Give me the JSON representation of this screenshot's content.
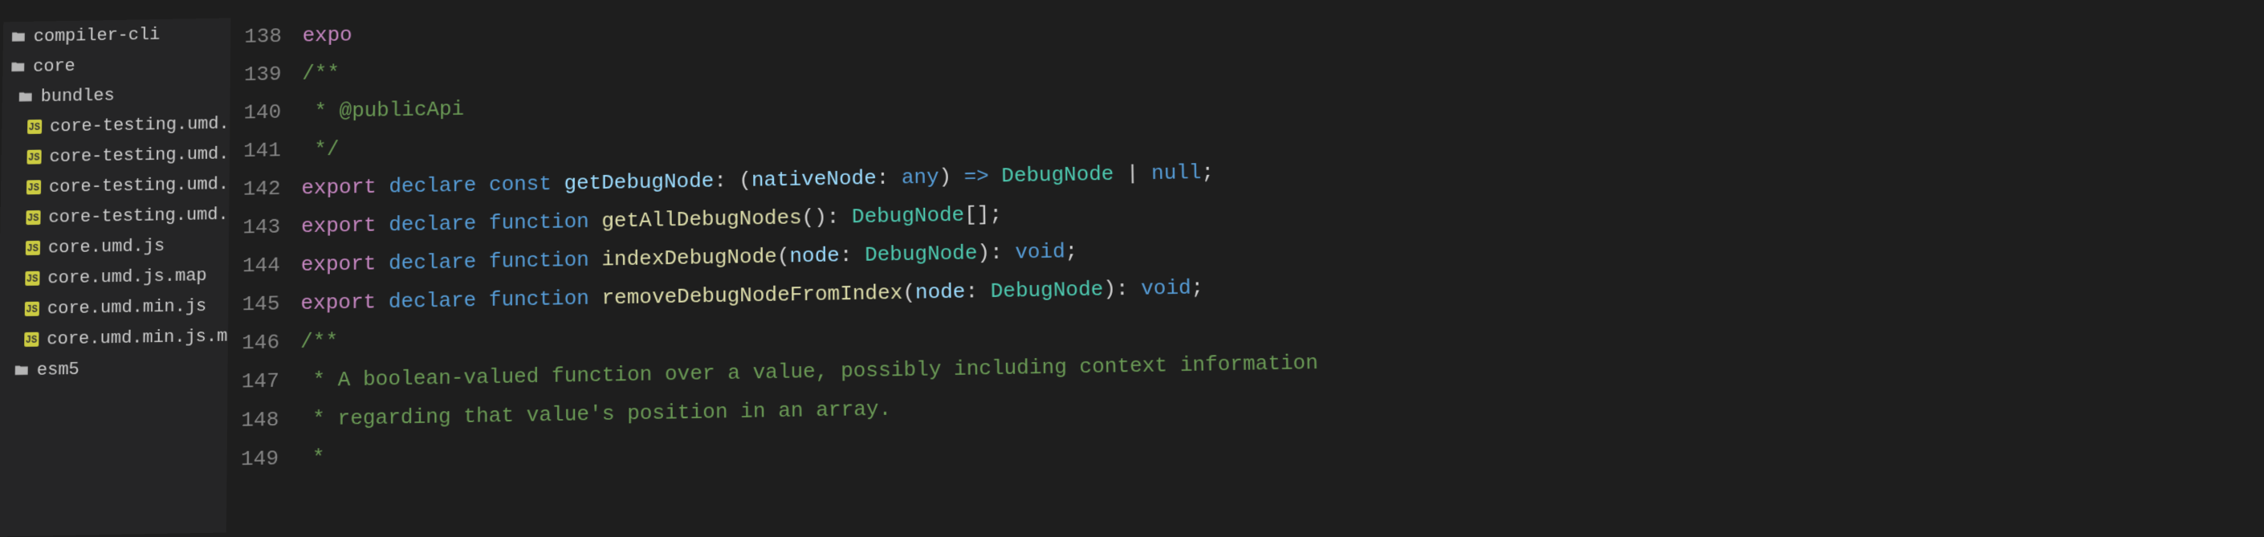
{
  "sidebar": {
    "items": [
      {
        "label": "compiler-cli",
        "type": "folder",
        "level": 1
      },
      {
        "label": "core",
        "type": "folder",
        "level": 1
      },
      {
        "label": "bundles",
        "type": "folder",
        "level": 2
      },
      {
        "label": "core-testing.umd.js",
        "type": "js",
        "level": 3
      },
      {
        "label": "core-testing.umd.js.map",
        "type": "js",
        "level": 3
      },
      {
        "label": "core-testing.umd.min.js",
        "type": "js",
        "level": 3
      },
      {
        "label": "core-testing.umd.min.js.map",
        "type": "js",
        "level": 3
      },
      {
        "label": "core.umd.js",
        "type": "js",
        "level": 3
      },
      {
        "label": "core.umd.js.map",
        "type": "js",
        "level": 3
      },
      {
        "label": "core.umd.min.js",
        "type": "js",
        "level": 3
      },
      {
        "label": "core.umd.min.js.map",
        "type": "js",
        "level": 3
      },
      {
        "label": "esm5",
        "type": "folder",
        "level": 2
      }
    ]
  },
  "editor": {
    "lineNumbers": [
      "138",
      "139",
      "140",
      "141",
      "142",
      "143",
      "144",
      "145",
      "146",
      "147",
      "148",
      "149"
    ],
    "lines": [
      [
        {
          "t": "keyword",
          "v": "expo"
        }
      ],
      [
        {
          "t": "comment",
          "v": "/**"
        }
      ],
      [
        {
          "t": "comment",
          "v": " * @publicApi"
        }
      ],
      [
        {
          "t": "comment",
          "v": " */"
        }
      ],
      [
        {
          "t": "keyword",
          "v": "export "
        },
        {
          "t": "declare",
          "v": "declare const "
        },
        {
          "t": "var",
          "v": "getDebugNode"
        },
        {
          "t": "punc",
          "v": ": ("
        },
        {
          "t": "var",
          "v": "nativeNode"
        },
        {
          "t": "punc",
          "v": ": "
        },
        {
          "t": "declare",
          "v": "any"
        },
        {
          "t": "punc",
          "v": ") "
        },
        {
          "t": "declare",
          "v": "=> "
        },
        {
          "t": "type",
          "v": "DebugNode"
        },
        {
          "t": "punc",
          "v": " | "
        },
        {
          "t": "declare",
          "v": "null"
        },
        {
          "t": "punc",
          "v": ";"
        }
      ],
      [
        {
          "t": "keyword",
          "v": "export "
        },
        {
          "t": "declare",
          "v": "declare function "
        },
        {
          "t": "func",
          "v": "getAllDebugNodes"
        },
        {
          "t": "punc",
          "v": "(): "
        },
        {
          "t": "type",
          "v": "DebugNode"
        },
        {
          "t": "punc",
          "v": "[];"
        }
      ],
      [
        {
          "t": "keyword",
          "v": "export "
        },
        {
          "t": "declare",
          "v": "declare function "
        },
        {
          "t": "func",
          "v": "indexDebugNode"
        },
        {
          "t": "punc",
          "v": "("
        },
        {
          "t": "var",
          "v": "node"
        },
        {
          "t": "punc",
          "v": ": "
        },
        {
          "t": "type",
          "v": "DebugNode"
        },
        {
          "t": "punc",
          "v": "): "
        },
        {
          "t": "declare",
          "v": "void"
        },
        {
          "t": "punc",
          "v": ";"
        }
      ],
      [
        {
          "t": "keyword",
          "v": "export "
        },
        {
          "t": "declare",
          "v": "declare function "
        },
        {
          "t": "func",
          "v": "removeDebugNodeFromIndex"
        },
        {
          "t": "punc",
          "v": "("
        },
        {
          "t": "var",
          "v": "node"
        },
        {
          "t": "punc",
          "v": ": "
        },
        {
          "t": "type",
          "v": "DebugNode"
        },
        {
          "t": "punc",
          "v": "): "
        },
        {
          "t": "declare",
          "v": "void"
        },
        {
          "t": "punc",
          "v": ";"
        }
      ],
      [
        {
          "t": "comment",
          "v": "/**"
        }
      ],
      [
        {
          "t": "comment",
          "v": " * A boolean-valued function over a value, possibly including context information"
        }
      ],
      [
        {
          "t": "comment",
          "v": " * regarding that value's position in an array."
        }
      ],
      [
        {
          "t": "comment",
          "v": " *"
        }
      ]
    ]
  }
}
